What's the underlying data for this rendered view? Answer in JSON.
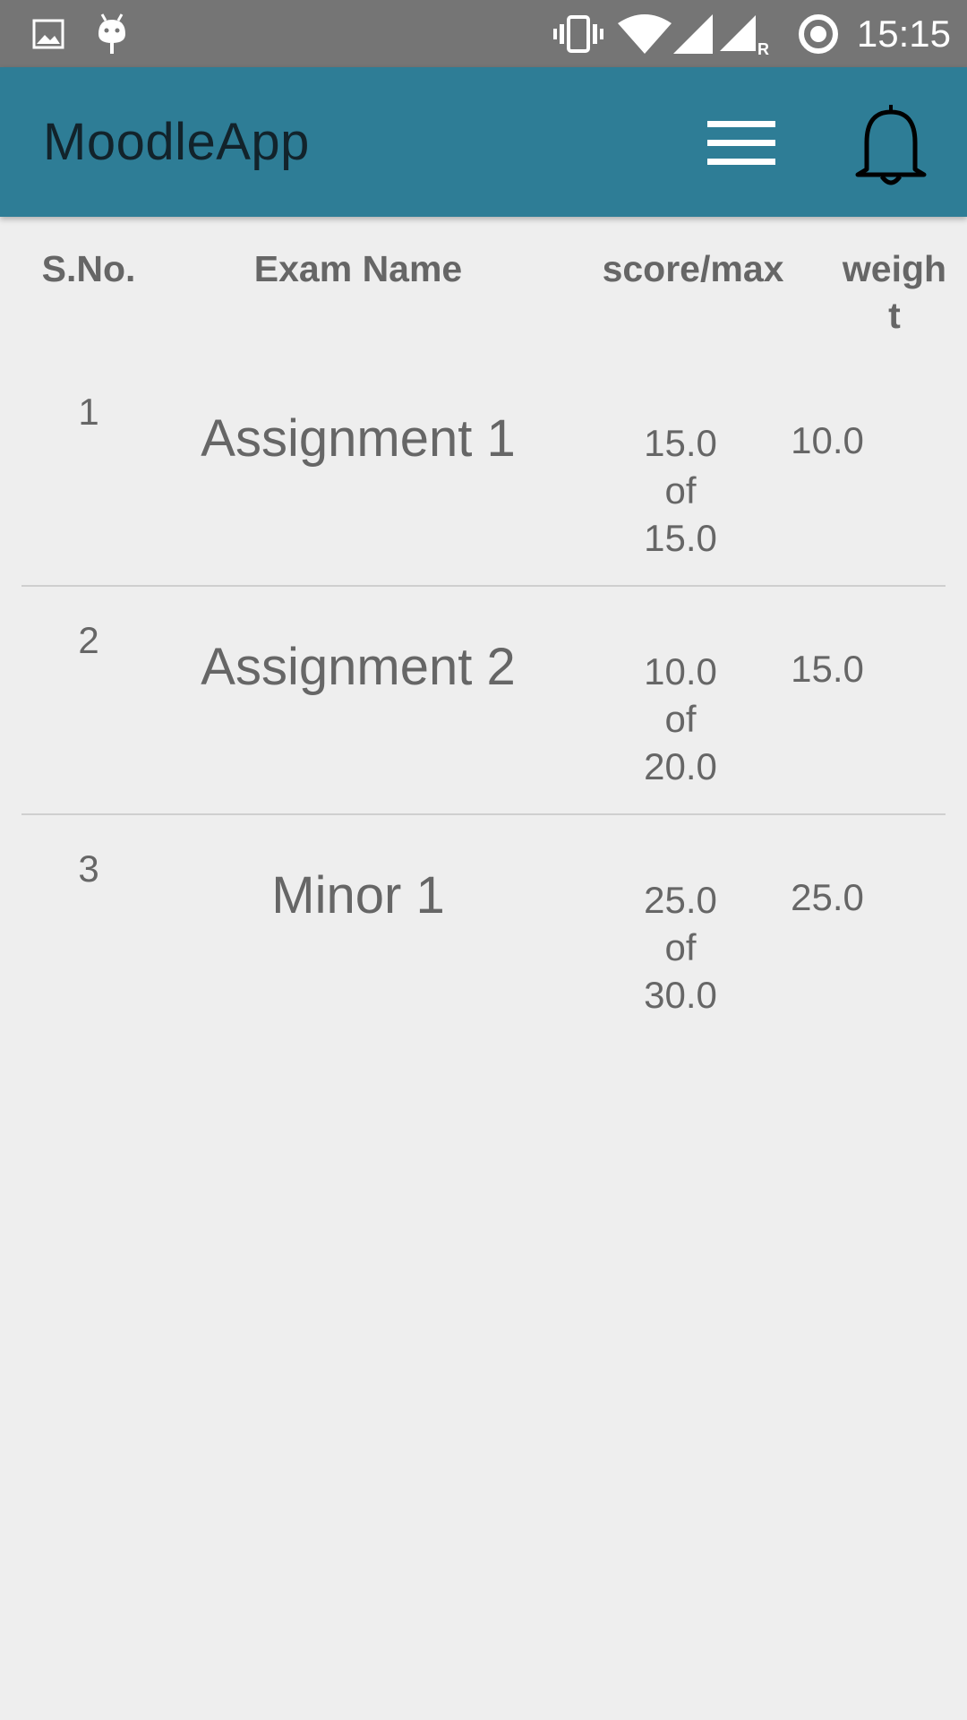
{
  "status_bar": {
    "time": "15:15",
    "left_icons": [
      "image-icon",
      "android-debug-icon"
    ],
    "right_icons": [
      "vibrate-icon",
      "wifi-icon",
      "signal-icon",
      "signal-roaming-icon",
      "sync-icon"
    ],
    "roaming_label": "R"
  },
  "app_bar": {
    "title": "MoodleApp",
    "menu_icon": "hamburger-menu-icon",
    "notification_icon": "bell-icon"
  },
  "table": {
    "headers": {
      "sno": "S.No.",
      "exam_name": "Exam Name",
      "score_max": "score/max",
      "weight": "weight"
    },
    "rows": [
      {
        "sno": "1",
        "exam_name": "Assignment 1",
        "score": "15.0",
        "of": "of",
        "max": "15.0",
        "weight": "10.0"
      },
      {
        "sno": "2",
        "exam_name": "Assignment 2",
        "score": "10.0",
        "of": "of",
        "max": "20.0",
        "weight": "15.0"
      },
      {
        "sno": "3",
        "exam_name": "Minor 1",
        "score": "25.0",
        "of": "of",
        "max": "30.0",
        "weight": "25.0"
      }
    ]
  },
  "colors": {
    "status_bar": "#757575",
    "app_bar": "#2e7d96",
    "background": "#eeeeee",
    "text": "#666666"
  }
}
